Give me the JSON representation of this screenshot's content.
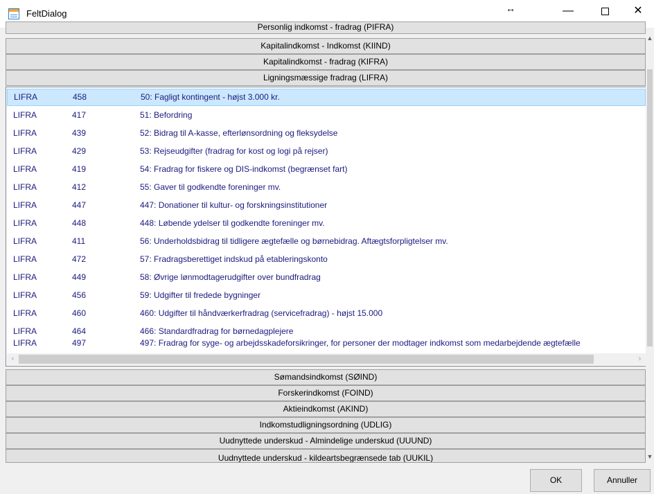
{
  "window": {
    "title": "FeltDialog",
    "icons": {
      "app": "table-icon",
      "resize": "resize-horizontal-icon",
      "minimize": "minimize-icon",
      "maximize": "maximize-icon",
      "close": "close-icon"
    },
    "glyphs": {
      "resize": "↔",
      "minimize": "—",
      "close": "✕"
    }
  },
  "groups_top": [
    "Personlig indkomst - fradrag (PIFRA)",
    "Kapitalindkomst - Indkomst (KIIND)",
    "Kapitalindkomst - fradrag (KIFRA)",
    "Ligningsmæssige fradrag (LIFRA)"
  ],
  "rows": [
    {
      "code": "LIFRA",
      "num": "458",
      "desc": "50: Fagligt kontingent - højst 3.000 kr."
    },
    {
      "code": "LIFRA",
      "num": "417",
      "desc": "51: Befordring"
    },
    {
      "code": "LIFRA",
      "num": "439",
      "desc": "52: Bidrag til A-kasse, efterlønsordning og fleksydelse"
    },
    {
      "code": "LIFRA",
      "num": "429",
      "desc": "53: Rejseudgifter (fradrag for kost og logi på rejser)"
    },
    {
      "code": "LIFRA",
      "num": "419",
      "desc": "54: Fradrag for fiskere og DIS-indkomst (begrænset fart)"
    },
    {
      "code": "LIFRA",
      "num": "412",
      "desc": "55: Gaver til godkendte foreninger mv."
    },
    {
      "code": "LIFRA",
      "num": "447",
      "desc": "447: Donationer til kultur- og forskningsinstitutioner"
    },
    {
      "code": "LIFRA",
      "num": "448",
      "desc": "448: Løbende ydelser til godkendte foreninger mv."
    },
    {
      "code": "LIFRA",
      "num": "411",
      "desc": "56: Underholdsbidrag til tidligere ægtefælle og børnebidrag. Aftægtsforpligtelser mv."
    },
    {
      "code": "LIFRA",
      "num": "472",
      "desc": "57: Fradragsberettiget indskud på etableringskonto"
    },
    {
      "code": "LIFRA",
      "num": "449",
      "desc": "58: Øvrige lønmodtagerudgifter over bundfradrag"
    },
    {
      "code": "LIFRA",
      "num": "456",
      "desc": "59: Udgifter til fredede bygninger"
    },
    {
      "code": "LIFRA",
      "num": "460",
      "desc": "460: Udgifter til håndværkerfradrag (servicefradrag) - højst 15.000"
    },
    {
      "code": "LIFRA",
      "num": "464",
      "desc": "466: Standardfradrag for børnedagplejere"
    },
    {
      "code": "LIFRA",
      "num": "497",
      "desc": "497: Fradrag for syge- og arbejdsskadeforsikringer, for personer der modtager indkomst som medarbejdende ægtefælle"
    }
  ],
  "selected_row": 0,
  "groups_bottom": [
    "Sømandsindkomst (SØIND)",
    "Forskerindkomst (FOIND)",
    "Aktieindkomst (AKIND)",
    "Indkomstudligningsordning (UDLIG)",
    "Uudnyttede underskud - Almindelige underskud (UUUND)",
    "Uudnyttede underskud - kildeartsbegrænsede tab (UUKIL)"
  ],
  "scroll_arrows": {
    "left": "‹",
    "right": "›",
    "up": "▲",
    "down": "▼"
  },
  "buttons": {
    "ok": "OK",
    "cancel": "Annuller"
  }
}
